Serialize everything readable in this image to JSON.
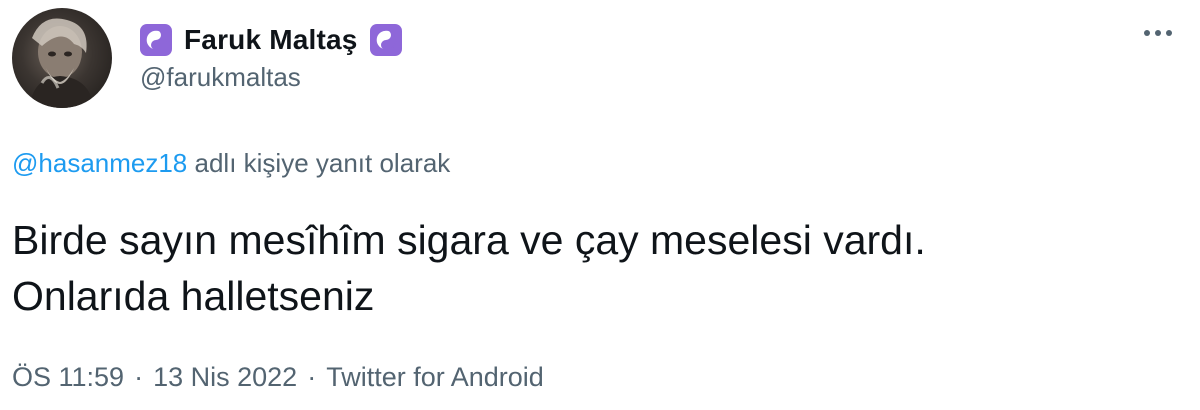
{
  "author": {
    "display_name": "Faruk Maltaş",
    "handle": "@farukmaltas",
    "badge_icon": "yin-yang-icon",
    "badge_color": "#8e67d9",
    "avatar_icon": "profile-photo"
  },
  "more_icon": "more-horizontal-icon",
  "reply": {
    "mention": "@hasanmez18",
    "suffix": " adlı kişiye yanıt olarak"
  },
  "tweet": {
    "line1": "Birde sayın mesîhîm sigara ve çay meselesi vardı.",
    "line2": "Onlarıda halletseniz"
  },
  "meta": {
    "time": "ÖS 11:59",
    "separator": "·",
    "date": "13 Nis 2022",
    "source": "Twitter for Android"
  },
  "colors": {
    "text": "#0f1419",
    "secondary": "#536471",
    "link": "#1d9bf0"
  }
}
